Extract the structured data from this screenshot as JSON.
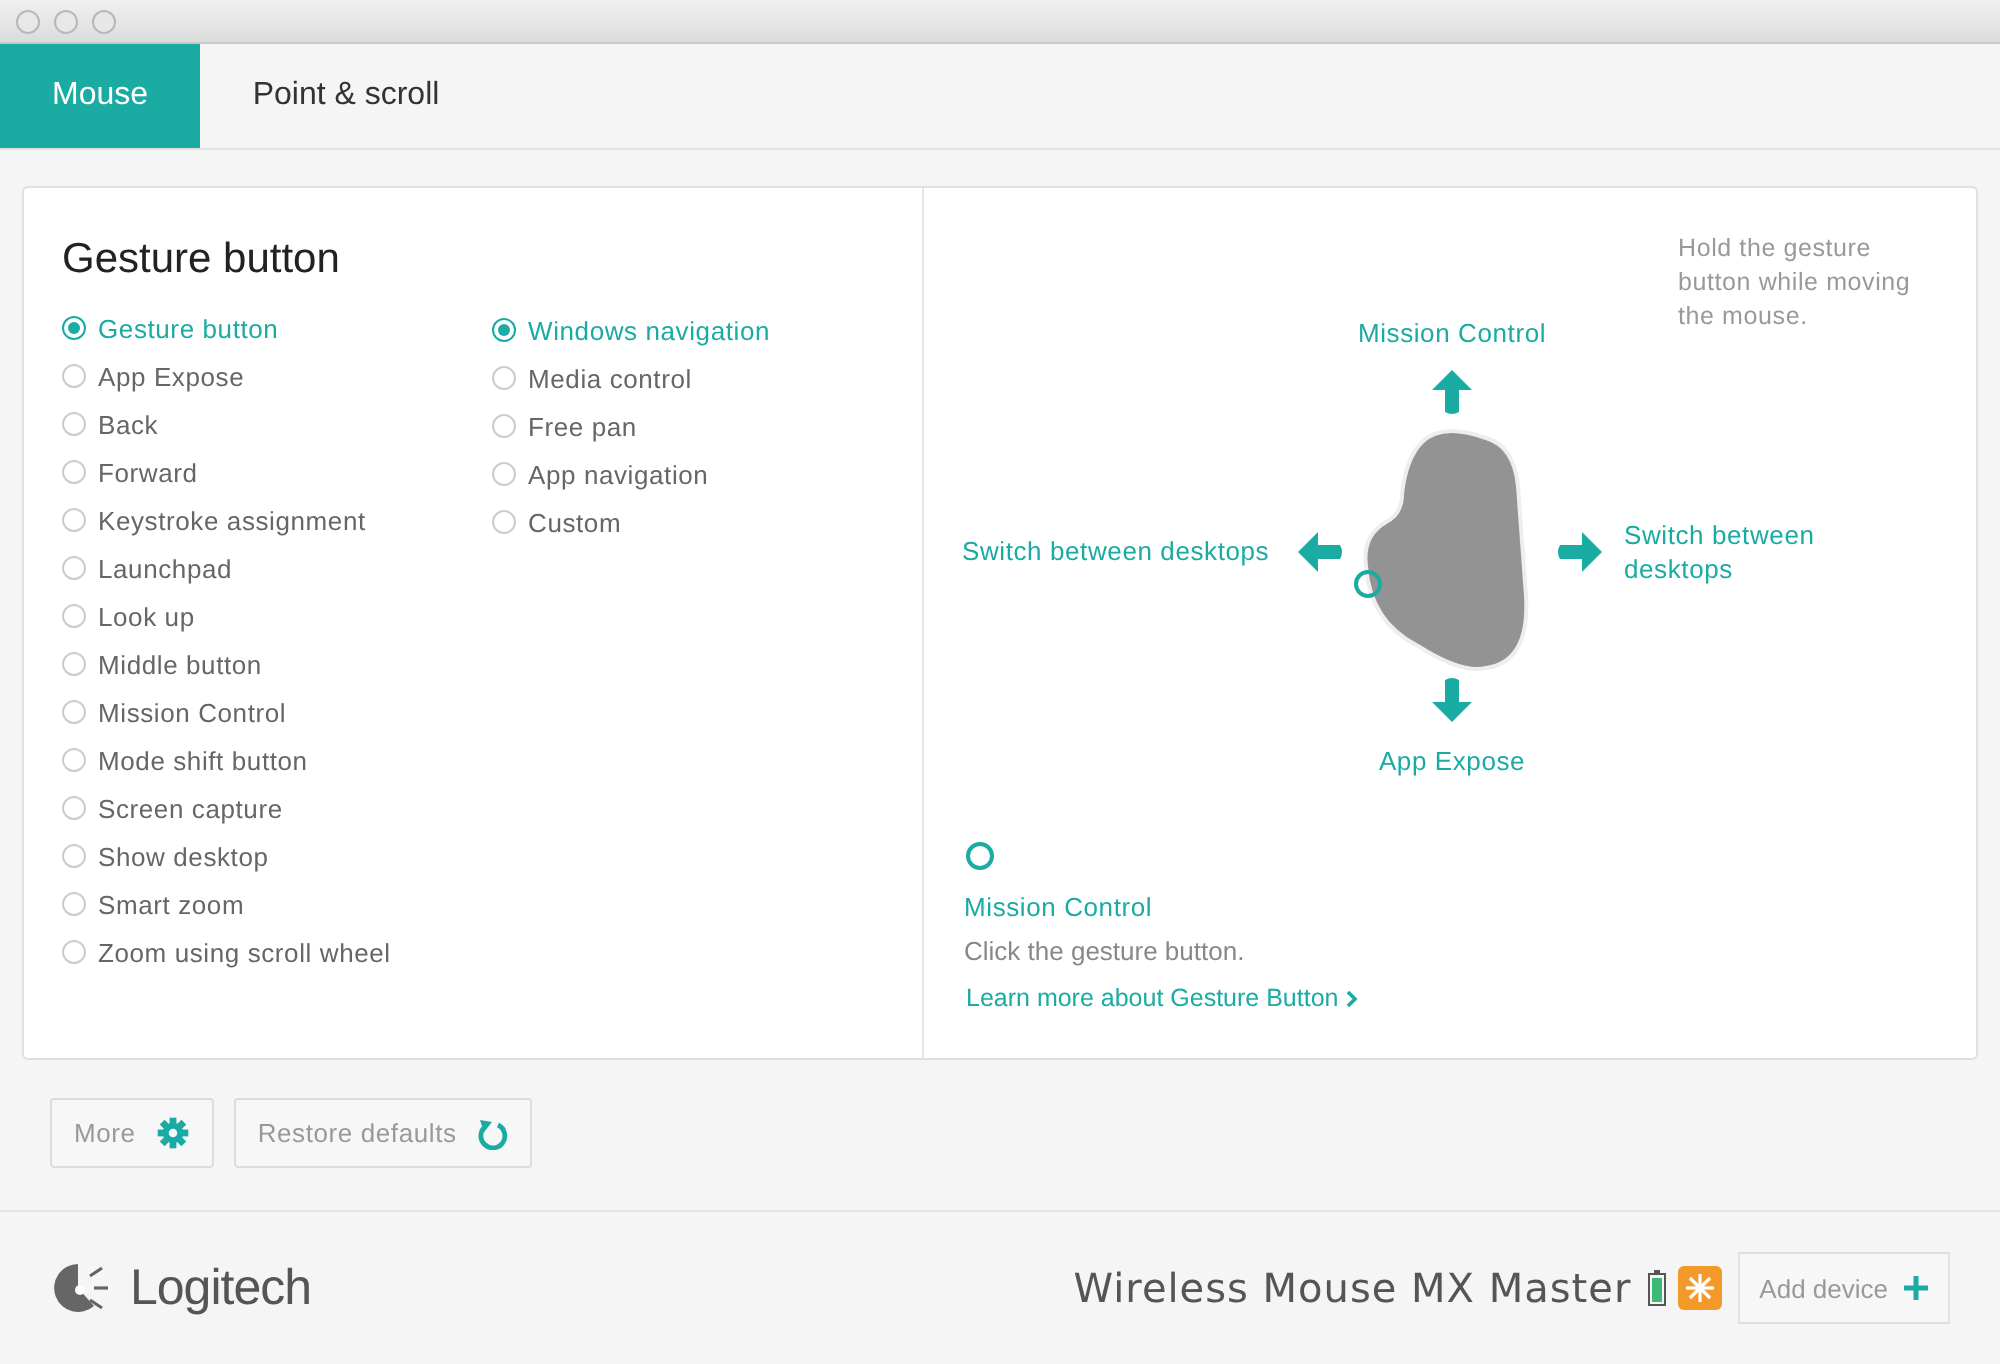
{
  "tabs": [
    {
      "label": "Mouse",
      "selected": true
    },
    {
      "label": "Point & scroll",
      "selected": false
    }
  ],
  "panel": {
    "title": "Gesture button",
    "options_left": [
      {
        "label": "Gesture button",
        "selected": true
      },
      {
        "label": "App Expose",
        "selected": false
      },
      {
        "label": "Back",
        "selected": false
      },
      {
        "label": "Forward",
        "selected": false
      },
      {
        "label": "Keystroke assignment",
        "selected": false
      },
      {
        "label": "Launchpad",
        "selected": false
      },
      {
        "label": "Look up",
        "selected": false
      },
      {
        "label": "Middle button",
        "selected": false
      },
      {
        "label": "Mission Control",
        "selected": false
      },
      {
        "label": "Mode shift button",
        "selected": false
      },
      {
        "label": "Screen capture",
        "selected": false
      },
      {
        "label": "Show desktop",
        "selected": false
      },
      {
        "label": "Smart zoom",
        "selected": false
      },
      {
        "label": "Zoom using scroll wheel",
        "selected": false
      }
    ],
    "options_right": [
      {
        "label": "Windows navigation",
        "selected": true
      },
      {
        "label": "Media control",
        "selected": false
      },
      {
        "label": "Free pan",
        "selected": false
      },
      {
        "label": "App navigation",
        "selected": false
      },
      {
        "label": "Custom",
        "selected": false
      }
    ],
    "diagram": {
      "hint": "Hold the gesture button while moving the mouse.",
      "up": "Mission Control",
      "left": "Switch between desktops",
      "right": "Switch between desktops",
      "down": "App Expose"
    },
    "detail": {
      "title": "Mission Control",
      "description": "Click the gesture button.",
      "link": "Learn more about Gesture Button"
    }
  },
  "buttons": [
    {
      "label": "More",
      "kind": "gear"
    },
    {
      "label": "Restore defaults",
      "kind": "restore"
    }
  ],
  "footer": {
    "logo": "Logitech",
    "device": "Wireless Mouse MX Master",
    "add_button": "Add device"
  }
}
